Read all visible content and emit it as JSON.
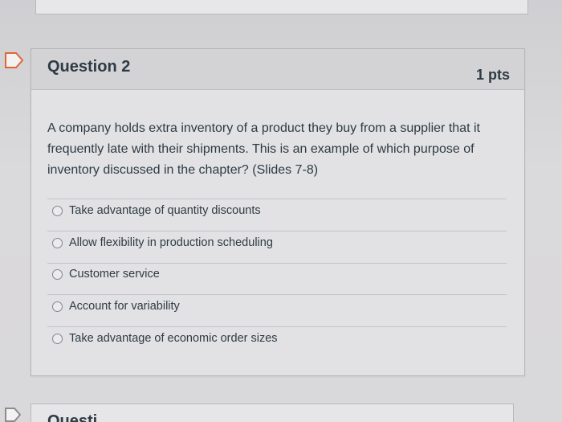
{
  "question": {
    "title": "Question 2",
    "points": "1 pts",
    "text": "A company holds extra inventory of a product they buy from a supplier that it frequently late with their shipments.  This is an example of which purpose of inventory discussed in the chapter? (Slides 7-8)",
    "options": [
      {
        "label": "Take advantage of quantity discounts"
      },
      {
        "label": "Allow flexibility in production scheduling"
      },
      {
        "label": "Customer service"
      },
      {
        "label": "Account for variability"
      },
      {
        "label": "Take advantage of economic order sizes"
      }
    ]
  },
  "next_question": {
    "title": "Questi"
  },
  "icons": {
    "flag": "bookmark-flag-icon",
    "radio": "radio-button-icon"
  },
  "colors": {
    "text": "#2d3b45",
    "flag_border": "#e0663a"
  }
}
